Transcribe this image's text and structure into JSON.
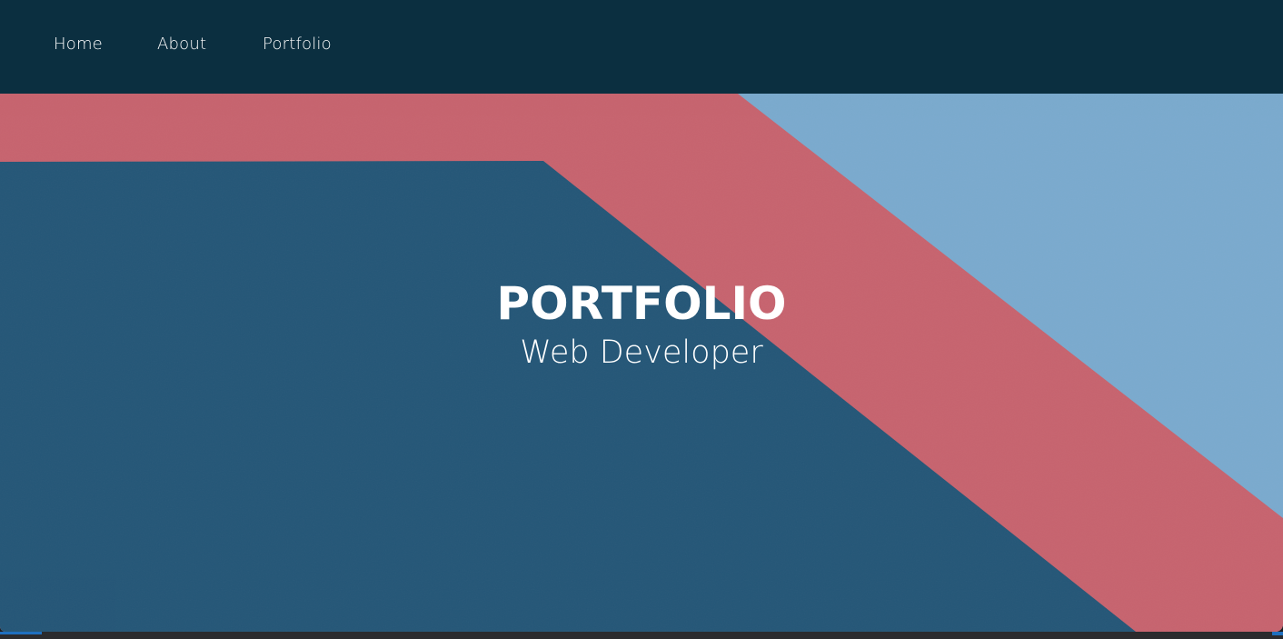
{
  "nav": {
    "items": [
      {
        "label": "Home"
      },
      {
        "label": "About"
      },
      {
        "label": "Portfolio"
      }
    ]
  },
  "hero": {
    "title": "PORTFOLIO",
    "subtitle": "Web Developer"
  },
  "colors": {
    "navbar": "#0b2f40",
    "hero_dark_blue": "#245677",
    "hero_red": "#c7636e",
    "hero_light_blue": "#7aaace",
    "text": "#ffffff"
  }
}
